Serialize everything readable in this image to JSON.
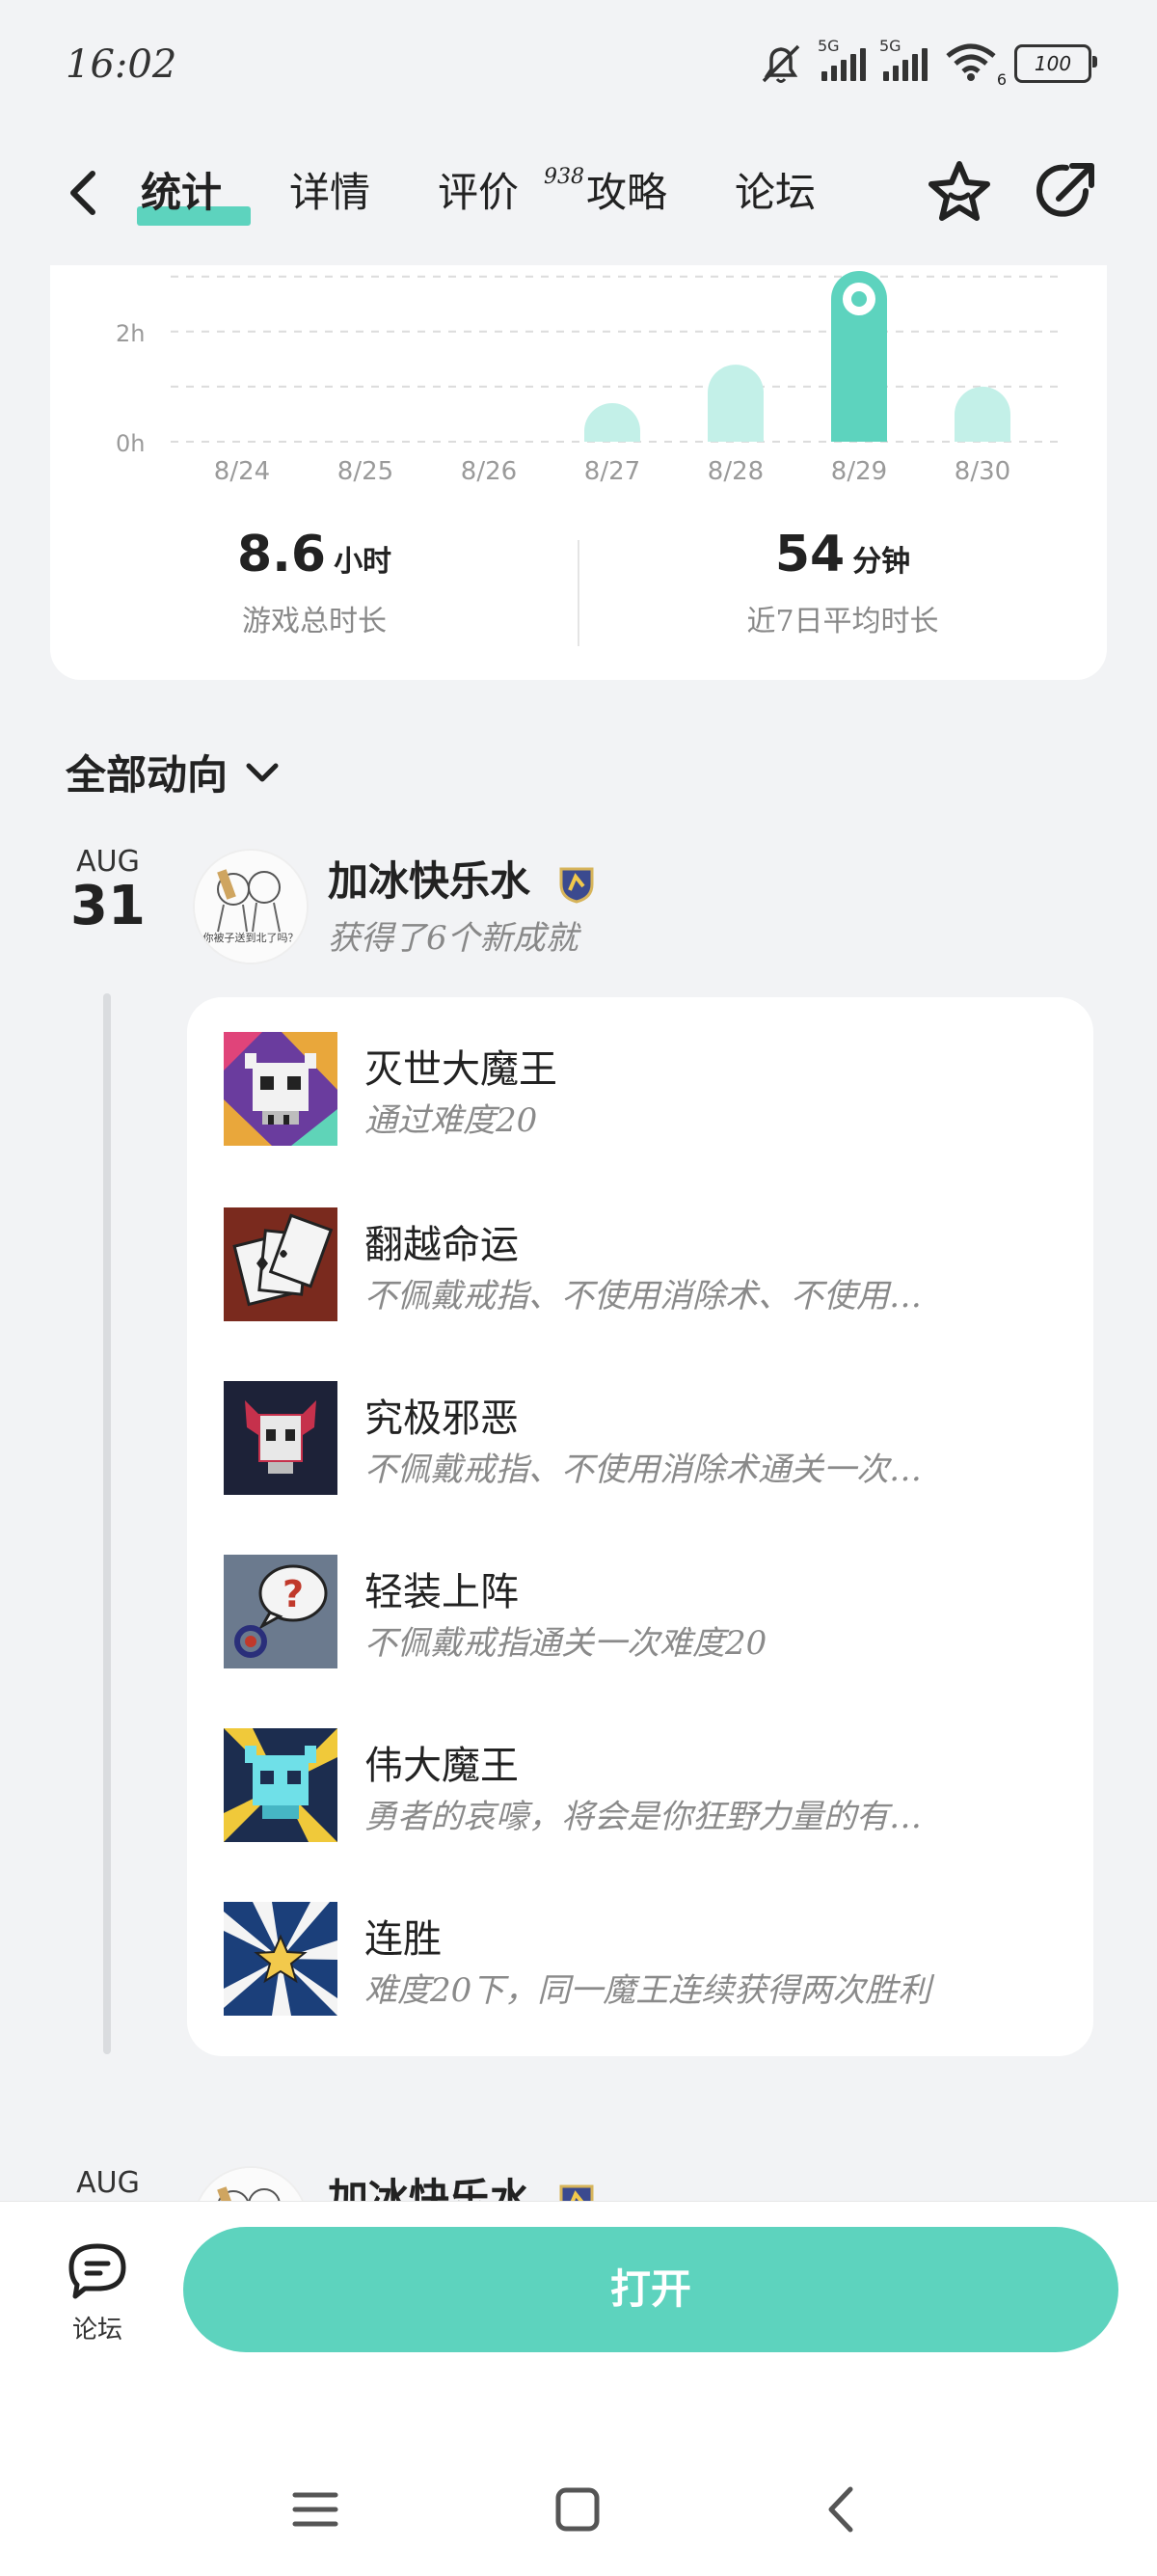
{
  "status_bar": {
    "time": "16:02",
    "network_1": "5G",
    "network_2": "5G",
    "wifi_badge": "6",
    "battery": "100"
  },
  "nav": {
    "tabs": [
      {
        "label": "统计",
        "active": true
      },
      {
        "label": "详情",
        "active": false
      },
      {
        "label": "评价",
        "active": false,
        "badge": "938"
      },
      {
        "label": "攻略",
        "active": false
      },
      {
        "label": "论坛",
        "active": false
      }
    ]
  },
  "chart_data": {
    "type": "bar",
    "categories": [
      "8/24",
      "8/25",
      "8/26",
      "8/27",
      "8/28",
      "8/29",
      "8/30"
    ],
    "values": [
      0,
      0,
      0,
      0.7,
      1.4,
      3.1,
      1.0
    ],
    "highlight_index": 5,
    "ytick_labels": [
      "2h",
      "0h"
    ],
    "ytick_values": [
      2,
      0
    ],
    "ylim": [
      0,
      3.1
    ],
    "grid": true,
    "colors": {
      "bar": "#c3f0e8",
      "highlight": "#5dd3be"
    }
  },
  "stats": {
    "total": {
      "value": "8.6",
      "unit": "小时",
      "label": "游戏总时长"
    },
    "avg": {
      "value": "54",
      "unit": "分钟",
      "label": "近7日平均时长"
    }
  },
  "filter": {
    "label": "全部动向"
  },
  "feed": [
    {
      "month": "AUG",
      "day": "31",
      "avatar_text": "你被子送到北了吗？",
      "user": "加冰快乐水",
      "action": "获得了6个新成就",
      "achievements": [
        {
          "title": "灭世大魔王",
          "desc": "通过难度20",
          "icon": "demon-skull-icon"
        },
        {
          "title": "翻越命运",
          "desc": "不佩戴戒指、不使用消除术、不使用…",
          "icon": "cards-icon"
        },
        {
          "title": "究极邪恶",
          "desc": "不佩戴戒指、不使用消除术通关一次…",
          "icon": "evil-skull-icon"
        },
        {
          "title": "轻装上阵",
          "desc": "不佩戴戒指通关一次难度20",
          "icon": "question-ring-icon"
        },
        {
          "title": "伟大魔王",
          "desc": "勇者的哀嚎，将会是你狂野力量的有…",
          "icon": "blue-skull-icon"
        },
        {
          "title": "连胜",
          "desc": "难度20下，同一魔王连续获得两次胜利",
          "icon": "star-burst-icon"
        }
      ]
    },
    {
      "month": "AUG",
      "user": "加冰快乐水"
    }
  ],
  "bottom": {
    "forum_label": "论坛",
    "open_label": "打开"
  },
  "colors": {
    "accent": "#5dd3be",
    "background": "#f2f3f5"
  }
}
